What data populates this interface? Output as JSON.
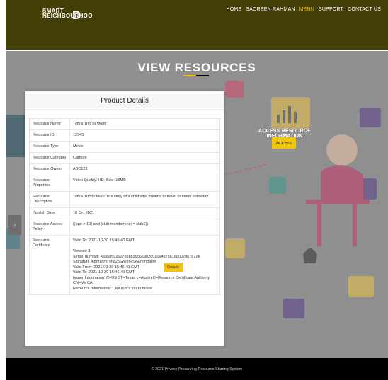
{
  "logo": {
    "line1": "SMART",
    "line2": "NEIGHBOURHOO",
    "big": "D"
  },
  "nav": [
    {
      "label": "HOME",
      "active": false
    },
    {
      "label": "SAOREEN RAHMAN",
      "active": false
    },
    {
      "label": "MENU",
      "active": true
    },
    {
      "label": "SUPPORT",
      "active": false
    },
    {
      "label": "CONTACT US",
      "active": false
    }
  ],
  "page_title": "VIEW RESOURCES",
  "access": {
    "label": "ACCESS RESOURCE INFORMATION",
    "button": "Access"
  },
  "card": {
    "title": "Product Details",
    "rows": [
      {
        "key": "Resource Name",
        "value": "Tom's Trip To Moon"
      },
      {
        "key": "Resource ID",
        "value": "12345"
      },
      {
        "key": "Resource Type",
        "value": "Movie"
      },
      {
        "key": "Resource Category",
        "value": "Cartoon"
      },
      {
        "key": "Resource Owner",
        "value": "ABC123"
      },
      {
        "key": "Resource Properties",
        "value": "Video Quality: HD, Size: 16MB"
      },
      {
        "key": "Resource Description",
        "value": "Tom's Trip to Moon is a story of a child who dreams to travel to moon someday."
      },
      {
        "key": "Publish Date",
        "value": "16 Oct 2021"
      },
      {
        "key": "Resource Access Policy",
        "value": "((age > 10) and (club membership = club1))"
      }
    ],
    "certificate": {
      "key": "Resource Certificate",
      "lines": [
        "Valid To: 2021-10-20 15:46:40 GMT",
        "",
        "Version: 3",
        "Serial_number: 4335959262793859956638260106497561680029678728",
        "Signature Algorithm: sha256WithRSAEncryption",
        "Valid From: 2021-09-20 15:46:40 GMT",
        "Valid To: 2021-10-20 15:46:40 GMT",
        "Issuer Information: C=US ST=Texas L=Austin O=Resource Certificate Authority CN=My CA",
        "Resource Information: CN=Tom's trip to moon"
      ],
      "details_button": "Details"
    }
  },
  "footer": "© 2021 Privacy Preserving Resource Sharing System",
  "icons": {
    "side_arrow": "chevron-right-icon"
  },
  "colors": {
    "header": "#443f06",
    "accent": "#f4c40a",
    "hero": "#8f8f8f",
    "footer": "#000000"
  }
}
